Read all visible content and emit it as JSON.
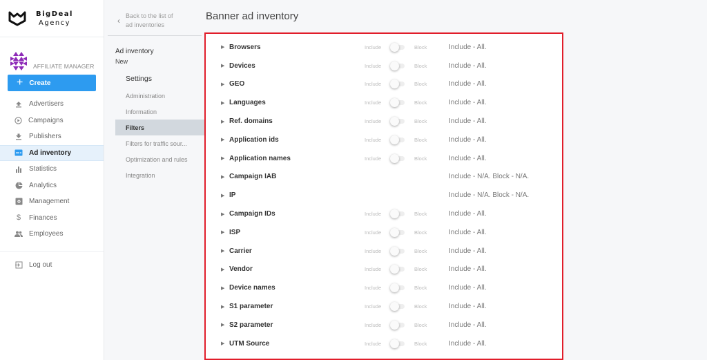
{
  "brand": {
    "line1": "BigDeal",
    "line2": "Agency"
  },
  "role": {
    "label": "AFFILIATE MANAGER"
  },
  "create_button": {
    "label": "Create"
  },
  "nav": {
    "items": [
      {
        "label": "Advertisers",
        "icon": "upload-icon",
        "active": false
      },
      {
        "label": "Campaigns",
        "icon": "play-circle-icon",
        "active": false
      },
      {
        "label": "Publishers",
        "icon": "download-icon",
        "active": false
      },
      {
        "label": "Ad inventory",
        "icon": "ad-inventory-icon",
        "active": true
      },
      {
        "label": "Statistics",
        "icon": "bar-chart-icon",
        "active": false
      },
      {
        "label": "Analytics",
        "icon": "pie-chart-icon",
        "active": false
      },
      {
        "label": "Management",
        "icon": "management-icon",
        "active": false
      },
      {
        "label": "Finances",
        "icon": "dollar-icon",
        "active": false
      },
      {
        "label": "Employees",
        "icon": "people-icon",
        "active": false
      }
    ],
    "logout": "Log out"
  },
  "subpanel": {
    "back_label": "Back to the list of ad inventories",
    "back_line1": "Back to the list of",
    "back_line2": "ad inventories",
    "title": "Ad inventory",
    "subtitle": "New",
    "settings_title": "Settings",
    "items": [
      {
        "label": "Administration",
        "active": false
      },
      {
        "label": "Information",
        "active": false
      },
      {
        "label": "Filters",
        "active": true
      },
      {
        "label": "Filters for traffic sour...",
        "active": false
      },
      {
        "label": "Optimization and rules",
        "active": false
      },
      {
        "label": "Integration",
        "active": false
      }
    ]
  },
  "main": {
    "title": "Banner ad inventory",
    "include_label": "Include",
    "block_label": "Block",
    "filters": [
      {
        "name": "Browsers",
        "toggle": true,
        "status": "Include - All."
      },
      {
        "name": "Devices",
        "toggle": true,
        "status": "Include - All."
      },
      {
        "name": "GEO",
        "toggle": true,
        "status": "Include - All."
      },
      {
        "name": "Languages",
        "toggle": true,
        "status": "Include - All."
      },
      {
        "name": "Ref. domains",
        "toggle": true,
        "status": "Include - All."
      },
      {
        "name": "Application ids",
        "toggle": true,
        "status": "Include - All."
      },
      {
        "name": "Application names",
        "toggle": true,
        "status": "Include - All."
      },
      {
        "name": "Campaign IAB",
        "toggle": false,
        "status": "Include - N/A. Block - N/A."
      },
      {
        "name": "IP",
        "toggle": false,
        "status": "Include - N/A. Block - N/A."
      },
      {
        "name": "Campaign IDs",
        "toggle": true,
        "status": "Include - All."
      },
      {
        "name": "ISP",
        "toggle": true,
        "status": "Include - All."
      },
      {
        "name": "Carrier",
        "toggle": true,
        "status": "Include - All."
      },
      {
        "name": "Vendor",
        "toggle": true,
        "status": "Include - All."
      },
      {
        "name": "Device names",
        "toggle": true,
        "status": "Include - All."
      },
      {
        "name": "S1 parameter",
        "toggle": true,
        "status": "Include - All."
      },
      {
        "name": "S2 parameter",
        "toggle": true,
        "status": "Include - All."
      },
      {
        "name": "UTM Source",
        "toggle": true,
        "status": "Include - All."
      }
    ]
  },
  "colors": {
    "accent": "#2d9bf0",
    "highlight_border": "#e11d2a",
    "role_logo": "#8e2bb8"
  }
}
